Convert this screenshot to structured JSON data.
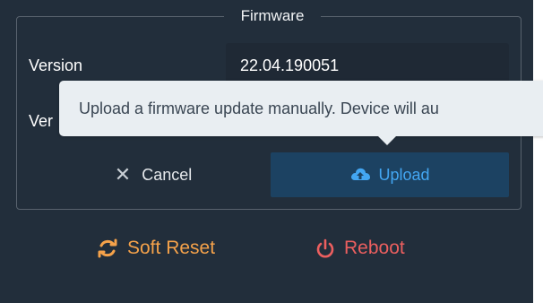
{
  "fieldset": {
    "legend": "Firmware",
    "version_label": "Version",
    "version_value": "22.04.190051",
    "second_label_partial": "Ver"
  },
  "tooltip": {
    "text": "Upload a firmware update manually. Device will au"
  },
  "buttons": {
    "cancel_label": "Cancel",
    "upload_label": "Upload",
    "cancel_icon": "close-icon",
    "upload_icon": "cloud-upload-icon"
  },
  "actions": {
    "soft_reset_label": "Soft Reset",
    "reboot_label": "Reboot",
    "soft_reset_icon": "sync-icon",
    "reboot_icon": "power-icon"
  },
  "colors": {
    "panel_bg": "#222e3b",
    "upload_bg": "#1c4262",
    "upload_text": "#43a6f2",
    "soft_reset": "#f5a24a",
    "reboot": "#ec5f5f",
    "tooltip_bg": "#e9eef2"
  }
}
